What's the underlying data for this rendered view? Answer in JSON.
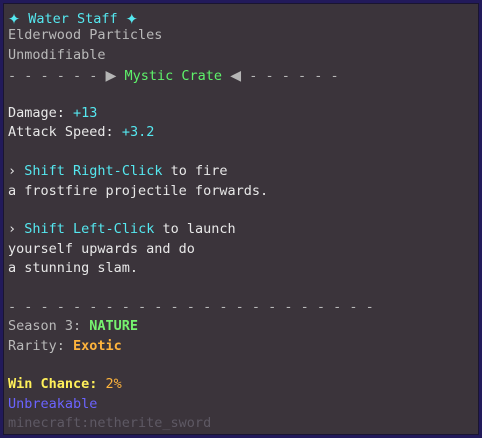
{
  "item": {
    "star_left": "✦",
    "name": "Water Staff",
    "star_right": "✦",
    "particles": "Elderwood Particles",
    "modifiable": "Unmodifiable",
    "crate": {
      "dashes_left": "- - - - - -",
      "arrow_left": "▶",
      "name": "Mystic Crate",
      "arrow_right": "◀",
      "dashes_right": "- - - - - -"
    },
    "stats": [
      {
        "label": "Damage:",
        "value": "+13"
      },
      {
        "label": "Attack Speed:",
        "value": "+3.2"
      }
    ],
    "abilities": [
      {
        "bullet": "›",
        "key": "Shift Right-Click",
        "text_first": " to fire",
        "lines": [
          "a frostfire projectile forwards."
        ]
      },
      {
        "bullet": "›",
        "key": "Shift Left-Click",
        "text_first": " to launch",
        "lines": [
          "yourself upwards and do",
          "a stunning slam."
        ]
      }
    ],
    "divider": "- - - - - - - - - - - - - - - - - - - - - - -",
    "season": {
      "label": "Season 3:",
      "value": "NATURE"
    },
    "rarity": {
      "label": "Rarity:",
      "value": "Exotic"
    },
    "win_chance": {
      "label": "Win Chance:",
      "value": "2%"
    },
    "unbreakable": "Unbreakable",
    "item_id": "minecraft:netherite_sword"
  },
  "colors": {
    "background": "#3b343b",
    "border": "#221a5a",
    "aqua": "#55e8f0",
    "green": "#5ef26a",
    "orange": "#ffb43c",
    "yellow": "#fff05a",
    "blue": "#6b63ff",
    "dim": "#5e5964"
  }
}
